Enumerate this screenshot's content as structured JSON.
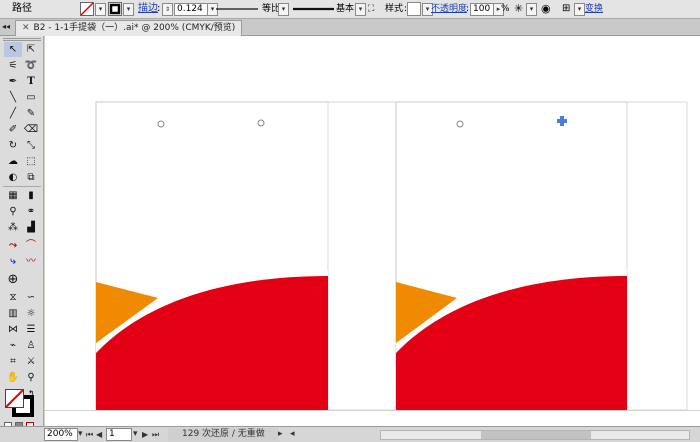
{
  "control_bar": {
    "selection_label": "路径",
    "stroke_label": "描边",
    "stroke_weight": "0.124",
    "profile_label": "等比",
    "brush_label": "基本",
    "style_label": "样式",
    "opacity_label": "不透明度",
    "opacity_value": "100",
    "percent": "%",
    "transform_label": "变换"
  },
  "document": {
    "tab_title": "B2 - 1-1手提袋（一）.ai* @ 200% (CMYK/预览)"
  },
  "status_bar": {
    "zoom": "200%",
    "page": "1",
    "status_text": "129 次还原 / 无重做"
  },
  "colors": {
    "red_shape": "#e30014",
    "orange_shape": "#f08a00",
    "artboard_border": "#c8c8c8"
  },
  "icons": {
    "tools": [
      "selection-tool-icon",
      "direct-selection-tool-icon",
      "magic-wand-icon",
      "lasso-icon",
      "pen-tool-icon",
      "type-tool-icon",
      "line-tool-icon",
      "rectangle-tool-icon",
      "paintbrush-icon",
      "pencil-icon",
      "blob-brush-icon",
      "eraser-icon",
      "rotate-tool-icon",
      "scale-tool-icon",
      "warp-tool-icon",
      "free-transform-icon",
      "shape-builder-icon",
      "perspective-grid-icon",
      "mesh-tool-icon",
      "gradient-tool-icon",
      "eyedropper-icon",
      "blend-tool-icon",
      "symbol-sprayer-icon",
      "graph-tool-icon",
      "artboard-tool-icon",
      "slice-tool-icon",
      "hand-tool-icon",
      "zoom-tool-icon"
    ]
  }
}
